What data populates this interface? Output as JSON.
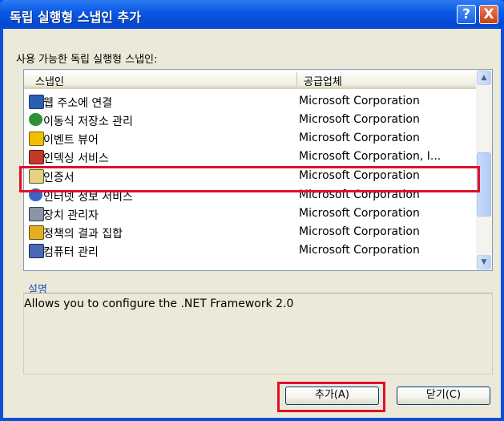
{
  "window": {
    "title": "독립 실행형 스냅인 추가",
    "help_label": "?",
    "close_label": "X"
  },
  "available_label": "사용 가능한 독립 실행형 스냅인:",
  "list": {
    "columns": [
      "스냅인",
      "공급업체"
    ],
    "rows": [
      {
        "name": "웹 주소에 연결",
        "vendor": "Microsoft Corporation",
        "icon": "web-link-icon"
      },
      {
        "name": "이동식 저장소 관리",
        "vendor": "Microsoft Corporation",
        "icon": "removable-storage-icon"
      },
      {
        "name": "이벤트 뷰어",
        "vendor": "Microsoft Corporation",
        "icon": "event-viewer-icon"
      },
      {
        "name": "인덱싱 서비스",
        "vendor": "Microsoft Corporation, I...",
        "icon": "indexing-service-icon"
      },
      {
        "name": "인증서",
        "vendor": "Microsoft Corporation",
        "icon": "certificate-icon"
      },
      {
        "name": "인터넷 정보 서비스",
        "vendor": "Microsoft Corporation",
        "icon": "iis-icon"
      },
      {
        "name": "장치 관리자",
        "vendor": "Microsoft Corporation",
        "icon": "device-manager-icon"
      },
      {
        "name": "정책의 결과 집합",
        "vendor": "Microsoft Corporation",
        "icon": "policy-result-icon"
      },
      {
        "name": "컴퓨터 관리",
        "vendor": "Microsoft Corporation",
        "icon": "computer-management-icon"
      }
    ]
  },
  "description": {
    "label": "설명",
    "text": "Allows you to configure the .NET Framework 2.0"
  },
  "buttons": {
    "add": "추가(A)",
    "close": "닫기(C)"
  }
}
